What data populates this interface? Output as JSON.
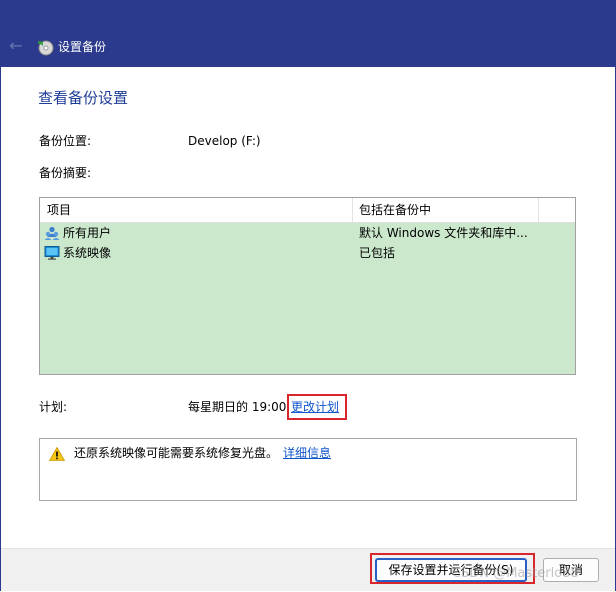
{
  "window": {
    "title": "设置备份",
    "back_glyph": "←",
    "icons": {
      "back": "back-arrow-icon",
      "app": "backup-disc-icon"
    }
  },
  "page": {
    "heading": "查看备份设置",
    "location_label": "备份位置:",
    "location_value": "Develop (F:)",
    "summary_label": "备份摘要:"
  },
  "table": {
    "columns": [
      "项目",
      "包括在备份中"
    ],
    "rows": [
      {
        "name": "所有用户",
        "value": "默认 Windows 文件夹和库中...",
        "icon": "users-icon"
      },
      {
        "name": "系统映像",
        "value": "已包括",
        "icon": "monitor-icon"
      }
    ],
    "selected_bg": "#cbe8cd"
  },
  "schedule": {
    "label": "计划:",
    "value": "每星期日的 19:00",
    "change_link": "更改计划"
  },
  "notice": {
    "icon": "warning-icon",
    "text": "还原系统映像可能需要系统修复光盘。",
    "link": "详细信息"
  },
  "footer": {
    "save_button": "保存设置并运行备份(S)",
    "cancel_button": "取消"
  },
  "watermark": "CSDN @Masterlo88",
  "colors": {
    "titlebar": "#2b3a8c",
    "heading": "#1e3d96",
    "link": "#1155cc",
    "highlight": "#d9262c"
  }
}
